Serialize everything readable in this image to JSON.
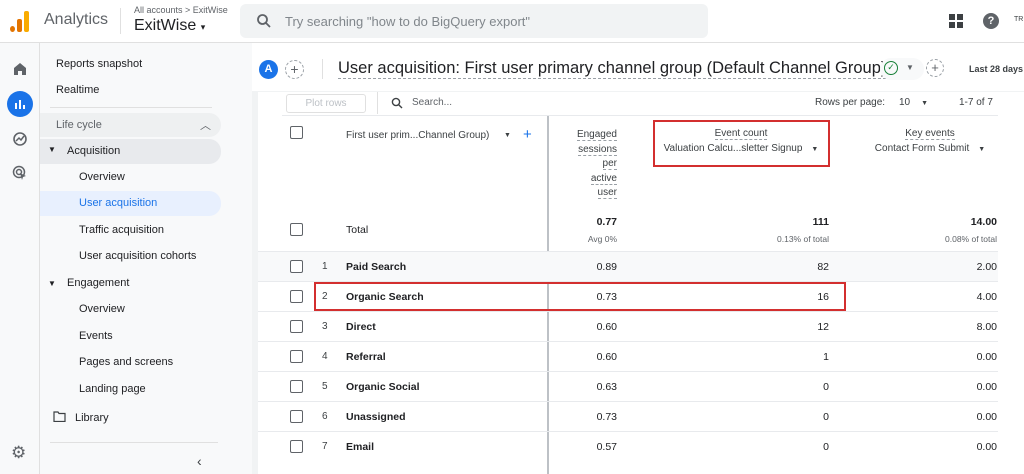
{
  "header": {
    "app_name": "Analytics",
    "breadcrumb": "All accounts > ExitWise",
    "property": "ExitWise",
    "search_placeholder": "Try searching \"how to do BigQuery export\"",
    "user_initials": "TR"
  },
  "rail": {
    "icons": [
      "home-icon",
      "reports-icon",
      "explore-icon",
      "advertising-icon",
      "settings-icon"
    ]
  },
  "sidebar": {
    "reports_snapshot": "Reports snapshot",
    "realtime": "Realtime",
    "section": "Life cycle",
    "acquisition": "Acquisition",
    "acq_items": [
      "Overview",
      "User acquisition",
      "Traffic acquisition",
      "User acquisition cohorts"
    ],
    "engagement": "Engagement",
    "eng_items": [
      "Overview",
      "Events",
      "Pages and screens",
      "Landing page"
    ],
    "library": "Library",
    "active_item": "User acquisition"
  },
  "report": {
    "avatar": "A",
    "title": "User acquisition: First user primary channel group (Default Channel Group)",
    "date_range": "Last 28 days"
  },
  "table": {
    "plot_rows": "Plot rows",
    "search_placeholder": "Search...",
    "rows_per_page_label": "Rows per page:",
    "rows_per_page": "10",
    "pagination": "1-7 of 7",
    "dimension_header": "First user prim...Channel Group)",
    "columns": [
      {
        "label": "Engaged sessions per active user",
        "label_lines": [
          "Engaged",
          "sessions",
          "per",
          "active",
          "user"
        ],
        "filter": ""
      },
      {
        "label": "Event count",
        "filter": "Valuation Calcu...sletter Signup"
      },
      {
        "label": "Key events",
        "filter": "Contact Form Submit"
      }
    ],
    "total": {
      "label": "Total",
      "values": [
        "0.77",
        "111",
        "14.00"
      ],
      "subs": [
        "Avg 0%",
        "0.13% of total",
        "0.08% of total"
      ]
    },
    "rows": [
      {
        "n": "1",
        "name": "Paid Search",
        "values": [
          "0.89",
          "82",
          "2.00"
        ]
      },
      {
        "n": "2",
        "name": "Organic Search",
        "values": [
          "0.73",
          "16",
          "4.00"
        ]
      },
      {
        "n": "3",
        "name": "Direct",
        "values": [
          "0.60",
          "12",
          "8.00"
        ]
      },
      {
        "n": "4",
        "name": "Referral",
        "values": [
          "0.60",
          "1",
          "0.00"
        ]
      },
      {
        "n": "5",
        "name": "Organic Social",
        "values": [
          "0.63",
          "0",
          "0.00"
        ]
      },
      {
        "n": "6",
        "name": "Unassigned",
        "values": [
          "0.73",
          "0",
          "0.00"
        ]
      },
      {
        "n": "7",
        "name": "Email",
        "values": [
          "0.57",
          "0",
          "0.00"
        ]
      }
    ]
  },
  "colors": {
    "accent": "#1a73e8",
    "highlight": "#d32f2f",
    "logo_orange": "#f9ab00",
    "logo_dark": "#e37400"
  }
}
